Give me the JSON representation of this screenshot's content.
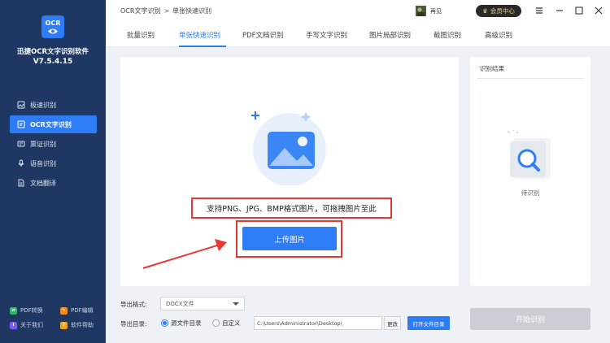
{
  "app": {
    "logo_text": "OCR",
    "name": "迅捷OCR文字识别软件",
    "version": "V7.5.4.15"
  },
  "sidebar": {
    "items": [
      {
        "label": "极速识别",
        "icon": "image-scan-icon",
        "active": false
      },
      {
        "label": "OCR文字识别",
        "icon": "ocr-icon",
        "active": true
      },
      {
        "label": "票证识别",
        "icon": "id-card-icon",
        "active": false
      },
      {
        "label": "语音识别",
        "icon": "microphone-icon",
        "active": false
      },
      {
        "label": "文档翻译",
        "icon": "translate-doc-icon",
        "active": false
      }
    ],
    "footer": [
      {
        "label": "PDF转换",
        "icon": "pdf-convert-icon",
        "color": "#35b36b"
      },
      {
        "label": "PDF编辑",
        "icon": "pdf-edit-icon",
        "color": "#f08a24"
      },
      {
        "label": "关于我们",
        "icon": "about-icon",
        "color": "#7a5cf0"
      },
      {
        "label": "软件帮助",
        "icon": "help-icon",
        "color": "#f0a324"
      }
    ]
  },
  "titlebar": {
    "breadcrumb": [
      "OCR文字识别",
      "单张快速识别"
    ],
    "breadcrumb_sep": ">",
    "user_name": "再见",
    "vip_label": "会员中心"
  },
  "tabs": [
    {
      "label": "批量识别",
      "active": false
    },
    {
      "label": "单张快速识别",
      "active": true
    },
    {
      "label": "PDF文档识别",
      "active": false
    },
    {
      "label": "手写文字识别",
      "active": false
    },
    {
      "label": "图片局部识别",
      "active": false
    },
    {
      "label": "截图识别",
      "active": false
    },
    {
      "label": "高级识别",
      "active": false
    }
  ],
  "upload": {
    "hint": "支持PNG、JPG、BMP格式图片，可拖拽图片至此",
    "button_label": "上传图片"
  },
  "result": {
    "title": "识别结果",
    "pending": "待识别"
  },
  "export": {
    "format_label": "导出格式:",
    "format_value": "DOCX文件",
    "dir_label": "导出目录:",
    "radio_source": "源文件目录",
    "radio_custom": "自定义",
    "path_value": "C:\\Users\\Administrator\\Desktop\\",
    "change_label": "更改",
    "open_dir_label": "打开文件目录",
    "start_label": "开始识别"
  },
  "colors": {
    "accent": "#2e7cf6",
    "sidebar_bg": "#1f3763",
    "highlight_red": "#e53935"
  }
}
